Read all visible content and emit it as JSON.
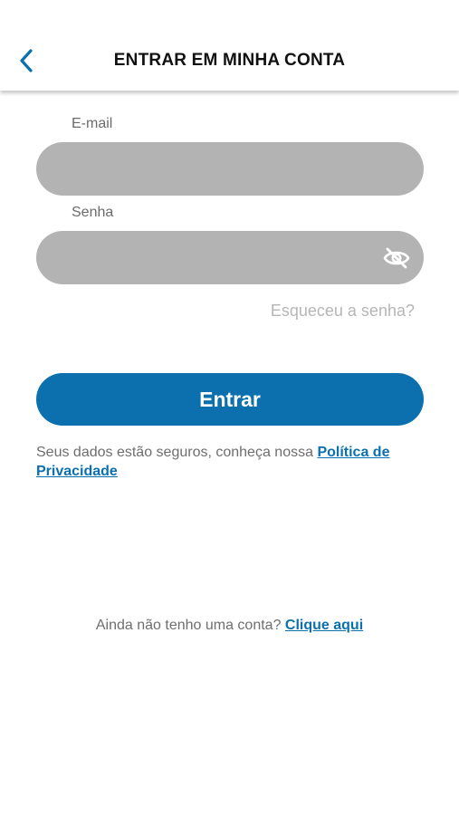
{
  "header": {
    "back_icon": "chevron-left-icon",
    "title": "ENTRAR EM MINHA CONTA"
  },
  "form": {
    "email_label": "E-mail",
    "email_value": "",
    "password_label": "Senha",
    "password_value": "",
    "visibility_icon": "eye-off-icon",
    "forgot_password": "Esqueceu a senha?",
    "submit_label": "Entrar"
  },
  "privacy": {
    "text": "Seus dados estão seguros, conheça nossa ",
    "link": "Política de Privacidade"
  },
  "signup": {
    "text": "Ainda não tenho uma conta? ",
    "link": "Clique aqui"
  },
  "colors": {
    "accent": "#0b70ad",
    "field_bg": "#b3b3b3",
    "muted_text": "#6e6e6e",
    "placeholder_text": "#b6b6b6"
  }
}
